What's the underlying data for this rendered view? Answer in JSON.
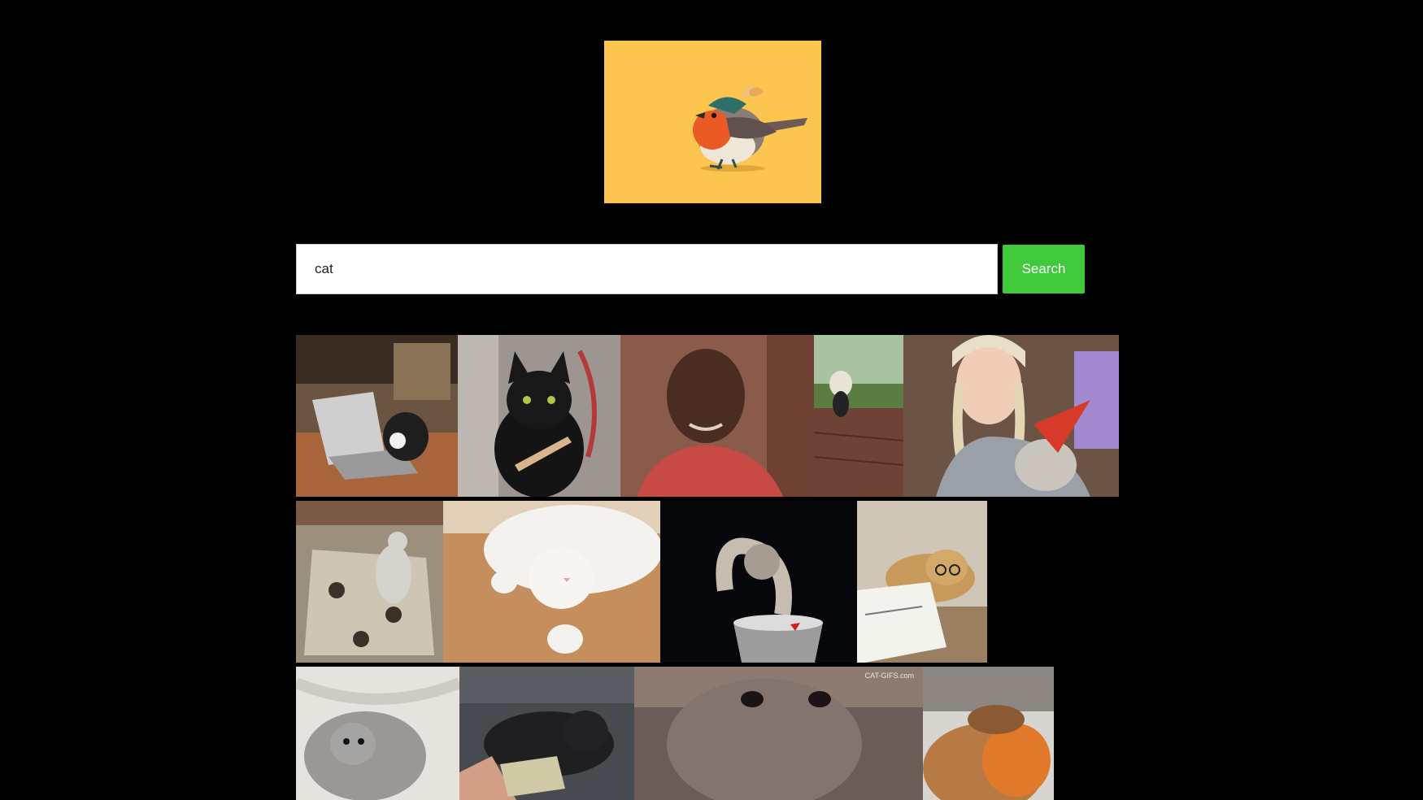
{
  "search": {
    "value": "cat",
    "button_label": "Search"
  },
  "logo": {
    "icon": "robin-bird-icon",
    "background_color": "#fbc54f"
  },
  "results": {
    "items": [
      {
        "icon": "cat-at-laptop-gif"
      },
      {
        "icon": "black-cat-nail-file-gif"
      },
      {
        "icon": "man-smiling-gif"
      },
      {
        "icon": "small-dog-walking-gif"
      },
      {
        "icon": "woman-holding-cat-party-hat-gif"
      },
      {
        "icon": "cat-dancing-on-rug-gif"
      },
      {
        "icon": "white-cat-rolling-gif"
      },
      {
        "icon": "cat-in-bucket-gif"
      },
      {
        "icon": "cat-with-glasses-reading-gif"
      },
      {
        "icon": "grey-kitten-gif"
      },
      {
        "icon": "black-kitten-with-money-gif"
      },
      {
        "icon": "cat-face-closeup-gif",
        "caption": "CAT-GIFS.com"
      },
      {
        "icon": "cat-with-orange-ball-gif"
      }
    ]
  },
  "colors": {
    "page_background": "#000000",
    "search_button": "#3fc93b"
  }
}
